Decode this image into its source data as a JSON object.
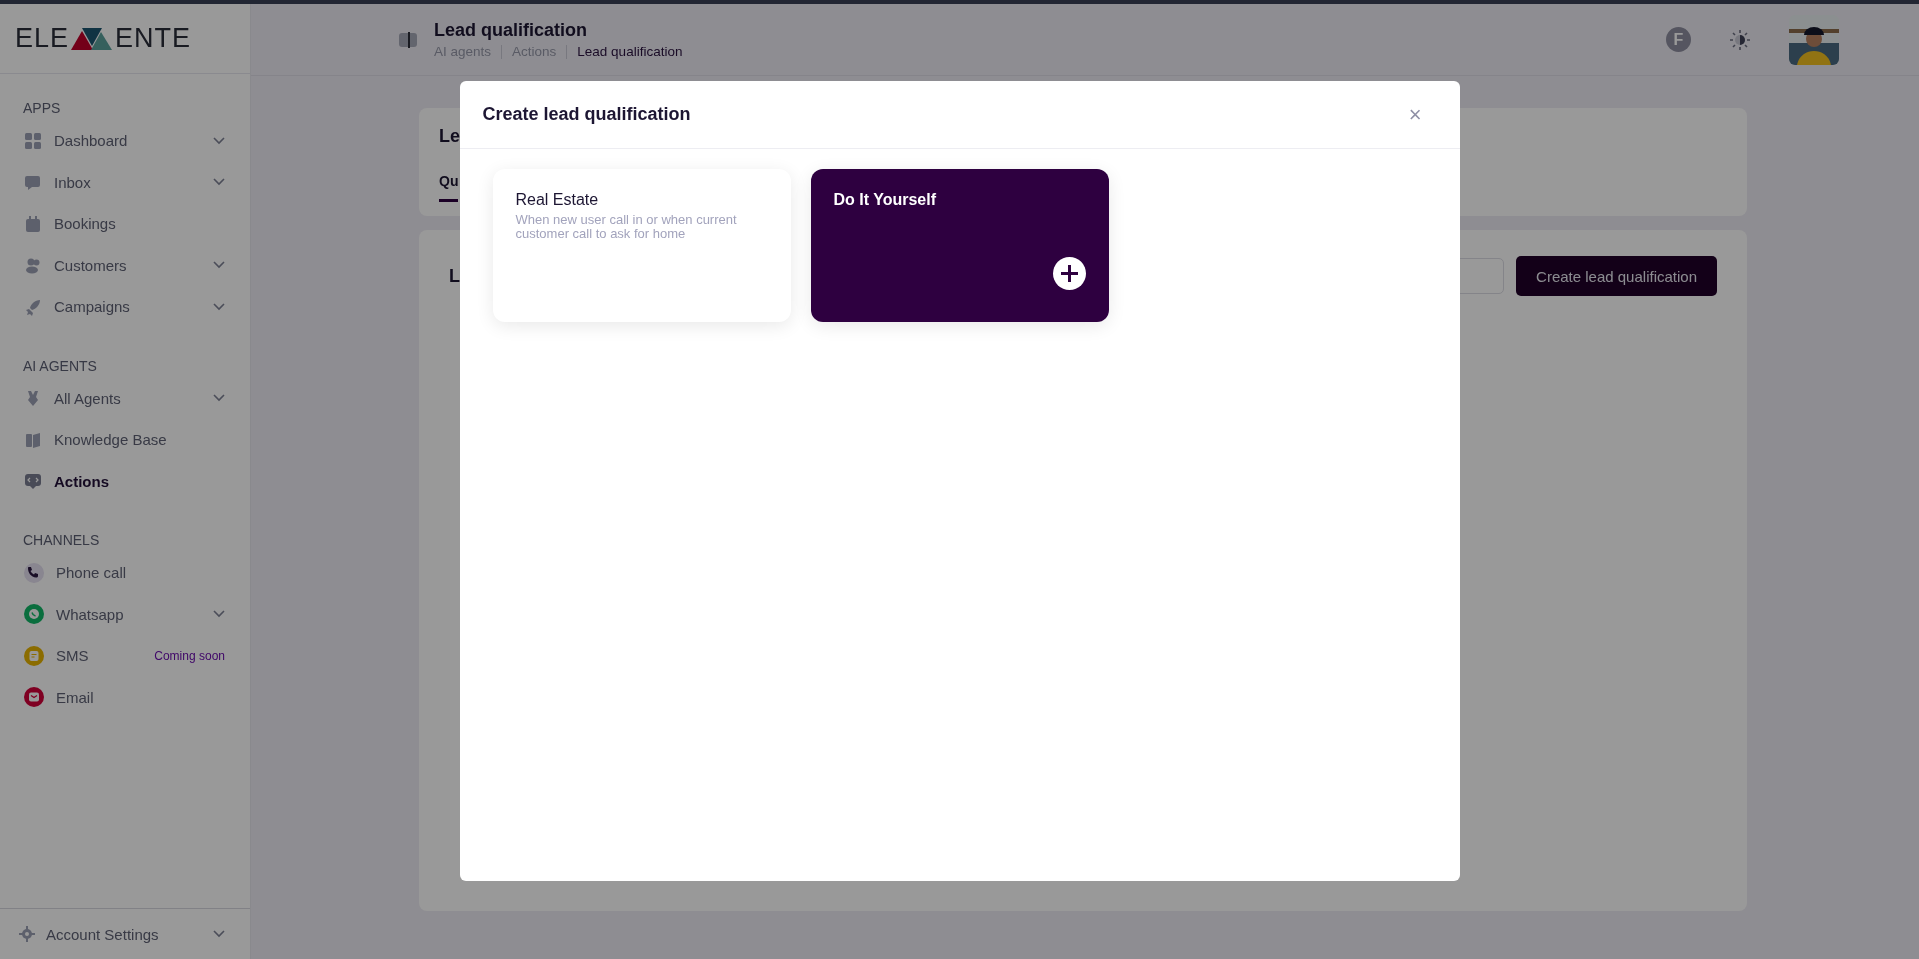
{
  "logo": {
    "left": "ELE",
    "right": "ENTE"
  },
  "sidebar": {
    "sections": [
      {
        "title": "APPS",
        "items": [
          {
            "label": "Dashboard",
            "expandable": true,
            "selected": false
          },
          {
            "label": "Inbox",
            "expandable": true,
            "selected": false
          },
          {
            "label": "Bookings",
            "expandable": false,
            "selected": false
          },
          {
            "label": "Customers",
            "expandable": true,
            "selected": false
          },
          {
            "label": "Campaigns",
            "expandable": true,
            "selected": false
          }
        ]
      },
      {
        "title": "AI AGENTS",
        "items": [
          {
            "label": "All Agents",
            "expandable": true,
            "selected": false
          },
          {
            "label": "Knowledge Base",
            "expandable": false,
            "selected": false
          },
          {
            "label": "Actions",
            "expandable": false,
            "selected": true
          }
        ]
      },
      {
        "title": "CHANNELS",
        "channels": [
          {
            "label": "Phone call",
            "expandable": false
          },
          {
            "label": "Whatsapp",
            "expandable": true
          },
          {
            "label": "SMS",
            "expandable": false,
            "badge": "Coming soon"
          },
          {
            "label": "Email",
            "expandable": false
          }
        ]
      }
    ],
    "footer": {
      "label": "Account Settings",
      "expandable": true
    }
  },
  "header": {
    "title": "Lead qualification",
    "breadcrumbs": [
      {
        "label": "AI agents",
        "selected": false
      },
      {
        "label": "Actions",
        "selected": false
      },
      {
        "label": "Lead qualification",
        "selected": true
      }
    ],
    "user_initial": "F"
  },
  "page": {
    "title": "Le",
    "tabs": [
      {
        "label": "Qu",
        "selected": true
      }
    ],
    "list_title": "L",
    "create_button": "Create lead qualification"
  },
  "modal": {
    "title": "Create lead qualification",
    "close": "×",
    "cards": [
      {
        "kind": "template",
        "title": "Real Estate",
        "description": "When new user call in or when current customer call to ask for home"
      },
      {
        "kind": "blank",
        "title": "Do It Yourself"
      }
    ]
  }
}
